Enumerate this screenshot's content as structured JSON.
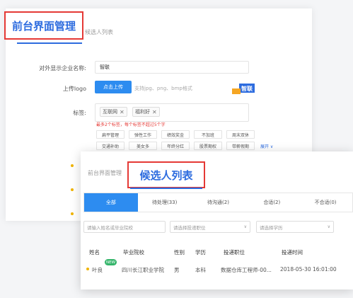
{
  "back": {
    "title": "前台界面管理",
    "breadcrumb": "候选人列表",
    "company_label": "对外显示企业名称:",
    "company_value": "智联",
    "logo_label": "上传logo",
    "upload_button": "点击上传",
    "upload_hint": "支持jpg、png、bmp格式",
    "logo_text": "智联",
    "tags_label": "标签:",
    "selected_tags": [
      "互联网",
      "福利好"
    ],
    "tag_warning": "最多2个标签，每个标签不超过5个字",
    "tag_options": [
      "扁平管理",
      "弹性工作",
      "绩效奖金",
      "不加班",
      "周末双休",
      "交通补助",
      "美女多",
      "年终分红",
      "股票期权",
      "带薪假期"
    ],
    "expand_label": "展开 ∨"
  },
  "front": {
    "breadcrumb": "前台界面管理",
    "title": "候选人列表",
    "tabs": [
      {
        "label": "全部",
        "active": true
      },
      {
        "label": "待处理(33)",
        "active": false
      },
      {
        "label": "待沟通(2)",
        "active": false
      },
      {
        "label": "合适(2)",
        "active": false
      },
      {
        "label": "不合适(0)",
        "active": false
      }
    ],
    "filters": {
      "search_placeholder": "请输入姓名或毕业院校",
      "position_placeholder": "请选择投递职位",
      "education_placeholder": "请选择学历"
    },
    "columns": [
      "姓名",
      "毕业院校",
      "性别",
      "学历",
      "投递职位",
      "投递时间"
    ],
    "row": {
      "badge": "NEW",
      "name": "叶良",
      "school": "四川长江职业学院",
      "gender": "男",
      "education": "本科",
      "position": "数据仓库工程师-00...",
      "time": "2018-05-30 16:01:00"
    }
  },
  "colors": {
    "accent": "#2d8cf0",
    "highlight": "#e53935",
    "title": "#2d6cdf",
    "badge": "#35b56b"
  }
}
